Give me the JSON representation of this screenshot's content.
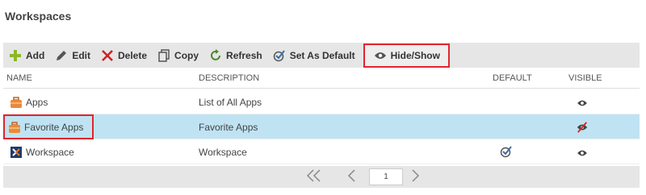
{
  "page": {
    "title": "Workspaces"
  },
  "toolbar": {
    "add": "Add",
    "edit": "Edit",
    "delete": "Delete",
    "copy": "Copy",
    "refresh": "Refresh",
    "set_default": "Set As Default",
    "hide_show": "Hide/Show"
  },
  "table": {
    "headers": {
      "name": "NAME",
      "description": "DESCRIPTION",
      "default": "DEFAULT",
      "visible": "VISIBLE"
    },
    "rows": [
      {
        "name": "Apps",
        "description": "List of All Apps",
        "default": false,
        "visible": true,
        "icon": "briefcase-icon"
      },
      {
        "name": "Favorite Apps",
        "description": "Favorite Apps",
        "default": false,
        "visible": false,
        "icon": "briefcase-icon"
      },
      {
        "name": "Workspace",
        "description": "Workspace",
        "default": true,
        "visible": true,
        "icon": "workspace-icon"
      }
    ]
  },
  "pager": {
    "page": "1"
  },
  "colors": {
    "highlight": "#e0262c",
    "selected_row": "#bfe3f3",
    "toolbar_bg": "#e6e6e6",
    "add_green": "#8cb827",
    "delete_red": "#cc2222"
  }
}
